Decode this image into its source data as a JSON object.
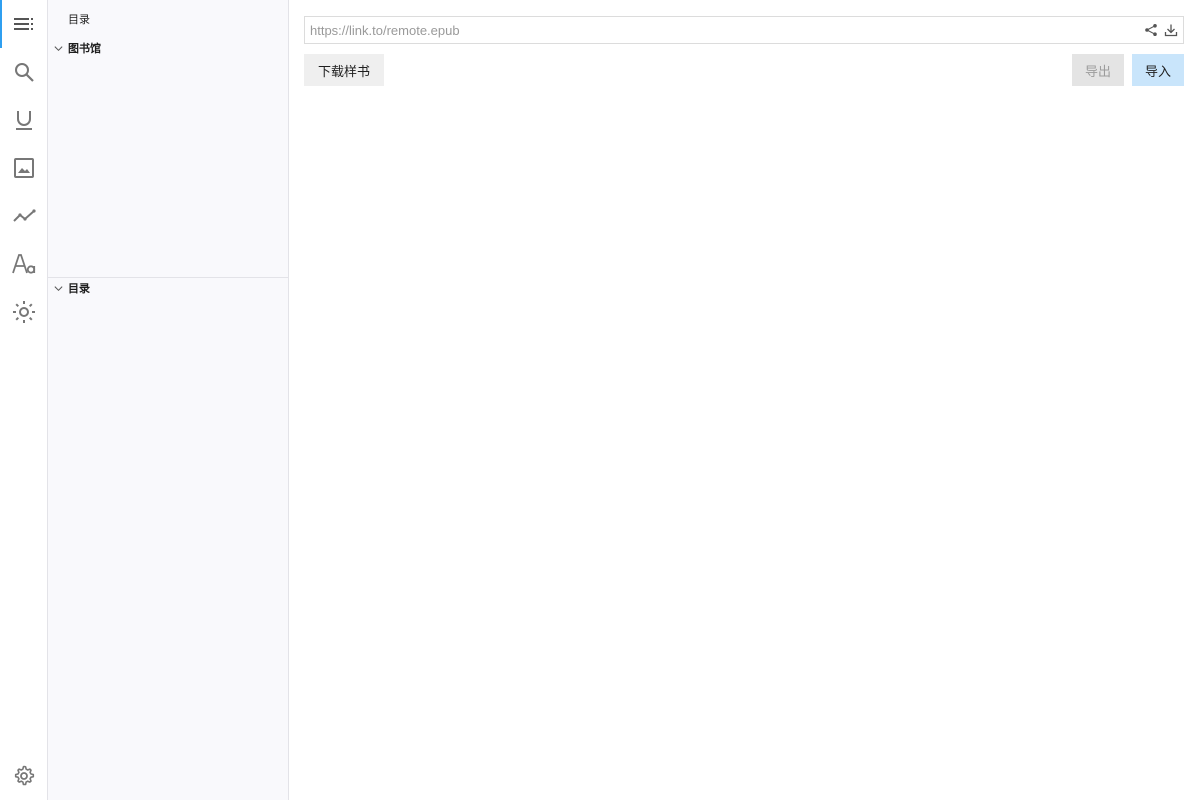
{
  "activity_bar": {
    "items": [
      {
        "name": "toc",
        "icon": "list-icon",
        "active": true
      },
      {
        "name": "search",
        "icon": "search-icon"
      },
      {
        "name": "annotations",
        "icon": "underline-icon"
      },
      {
        "name": "images",
        "icon": "image-icon"
      },
      {
        "name": "timeline",
        "icon": "chart-line-icon"
      },
      {
        "name": "typography",
        "icon": "font-icon"
      },
      {
        "name": "theme",
        "icon": "sun-icon"
      }
    ],
    "settings_icon": "gear-icon",
    "accent_color": "#2f9ff0"
  },
  "sidebar": {
    "title": "目录",
    "sections": [
      {
        "label": "图书馆",
        "expanded": true
      },
      {
        "label": "目录",
        "expanded": true
      }
    ]
  },
  "main": {
    "url_input": {
      "placeholder": "https://link.to/remote.epub",
      "value": ""
    },
    "url_actions": [
      {
        "icon": "share-icon"
      },
      {
        "icon": "download-icon"
      }
    ],
    "buttons": {
      "sample": "下载样书",
      "export": "导出",
      "import": "导入"
    }
  }
}
